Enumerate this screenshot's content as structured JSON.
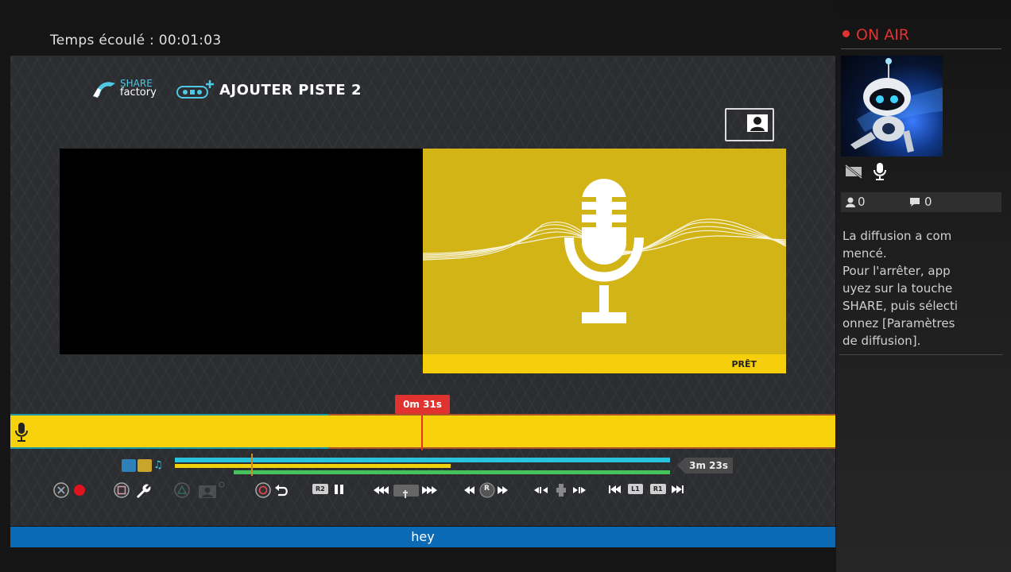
{
  "header": {
    "elapsed_label": "Temps écoulé :",
    "elapsed_time": "00:01:03"
  },
  "editor": {
    "brand": {
      "line1": "SHARE",
      "line2": "factory"
    },
    "title": "AJOUTER PISTE 2",
    "panel_status": "PRÊT",
    "playhead_time": "0m 31s",
    "duration": "3m 23s",
    "caption": "hey",
    "controls": {
      "r2": "R2",
      "r": "R",
      "l1": "L1",
      "r1": "R1"
    }
  },
  "stream": {
    "status": "ON AIR",
    "viewers": "0",
    "comments": "0",
    "message": "La diffusion a com\nmencé.\nPour l'arrêter, app\nuyez sur la touche\nSHARE, puis sélecti\nonnez [Paramètres\nde diffusion]."
  },
  "colors": {
    "accent_red": "#e0322e",
    "track_yellow": "#f7d20a",
    "caption_blue": "#0c6ab5",
    "timeline_cyan": "#27c4dc",
    "timeline_green": "#46c25d"
  },
  "icons": [
    "microphone-icon",
    "camera-off-icon",
    "user-icon",
    "chat-icon",
    "cross-button-icon",
    "square-button-icon",
    "wrench-icon",
    "triangle-button-icon",
    "circle-button-icon",
    "undo-icon",
    "pause-icon",
    "rewind-icon",
    "fast-forward-icon",
    "skip-back-icon",
    "skip-forward-icon",
    "record-dot-icon"
  ]
}
